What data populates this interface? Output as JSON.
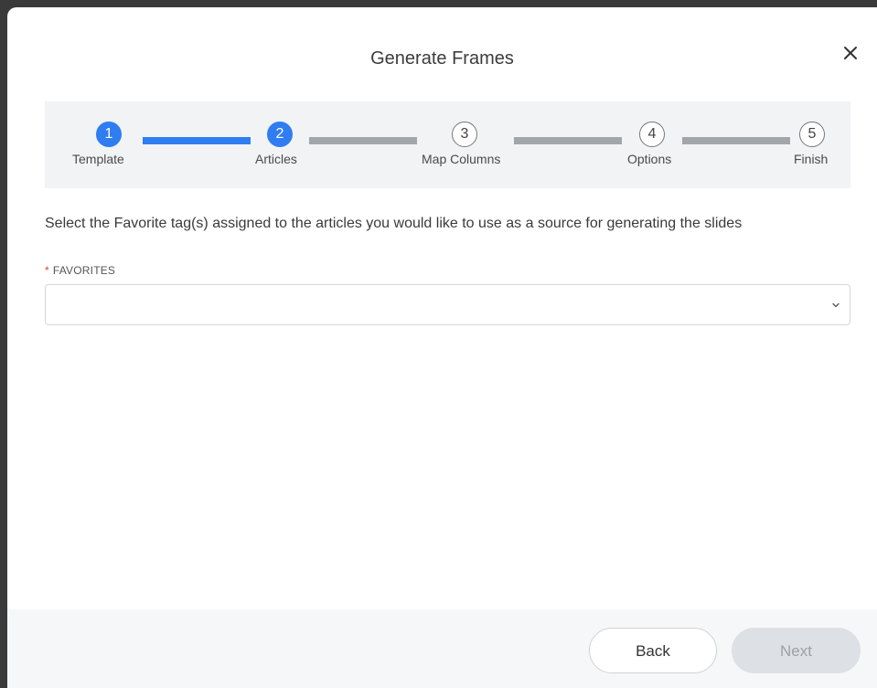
{
  "dialog": {
    "title": "Generate Frames",
    "close_icon": "close-icon"
  },
  "stepper": {
    "steps": [
      {
        "number": "1",
        "label": "Template",
        "state": "active"
      },
      {
        "number": "2",
        "label": "Articles",
        "state": "active"
      },
      {
        "number": "3",
        "label": "Map Columns",
        "state": "inactive"
      },
      {
        "number": "4",
        "label": "Options",
        "state": "inactive"
      },
      {
        "number": "5",
        "label": "Finish",
        "state": "inactive"
      }
    ],
    "colors": {
      "active": "#2f7df1",
      "inactive": "#a2a6ab"
    }
  },
  "form": {
    "instruction": "Select the Favorite tag(s) assigned to the articles you would like to use as a source for generating the slides",
    "favorites_label": "FAVORITES",
    "required_mark": "*",
    "favorites_value": ""
  },
  "footer": {
    "back_label": "Back",
    "next_label": "Next"
  }
}
